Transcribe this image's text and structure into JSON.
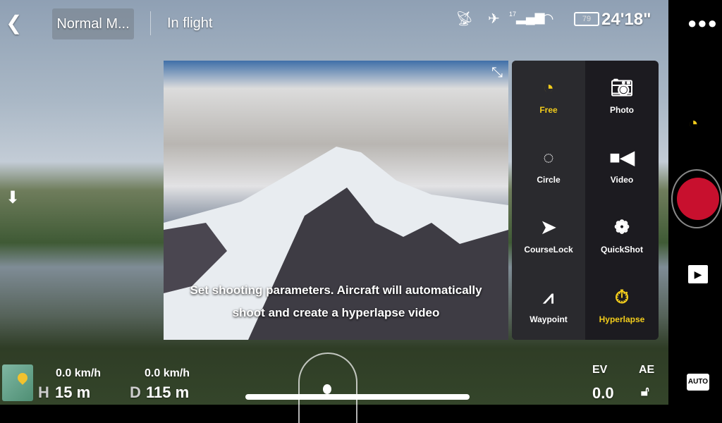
{
  "topbar": {
    "back_icon": "chevron-left-icon",
    "mode_label": "Normal M...",
    "status": "In flight",
    "signal_count": "17",
    "battery": "79",
    "flight_time": "24'18\"",
    "more_icon": "more-dots-icon"
  },
  "preview": {
    "caption_line1": "Set shooting parameters. Aircraft will automatically",
    "caption_line2": "shoot and create a hyperlapse video",
    "collapse_icon": "collapse-arrows-icon"
  },
  "menu": {
    "items": [
      {
        "label": "Free",
        "icon": "free-timer-icon",
        "selected": true
      },
      {
        "label": "Photo",
        "icon": "camera-icon",
        "selected": false
      },
      {
        "label": "Circle",
        "icon": "circle-orbit-icon",
        "selected": false
      },
      {
        "label": "Video",
        "icon": "video-camera-icon",
        "selected": false
      },
      {
        "label": "CourseLock",
        "icon": "courselock-arrow-icon",
        "selected": false
      },
      {
        "label": "QuickShot",
        "icon": "film-reel-icon",
        "selected": false
      },
      {
        "label": "Waypoint",
        "icon": "waypoint-icon",
        "selected": false
      },
      {
        "label": "Hyperlapse",
        "icon": "stopwatch-icon",
        "selected": true
      }
    ]
  },
  "telemetry": {
    "h_speed": "0.0 km/h",
    "h_label": "H",
    "h_value": "15 m",
    "d_speed": "0.0 km/h",
    "d_label": "D",
    "d_value": "115 m",
    "ev_label": "EV",
    "ev_value": "0.0",
    "ae_label": "AE"
  },
  "rail": {
    "auto_label": "AUTO"
  },
  "colors": {
    "accent": "#f2cc1b",
    "record": "#c8102e"
  }
}
